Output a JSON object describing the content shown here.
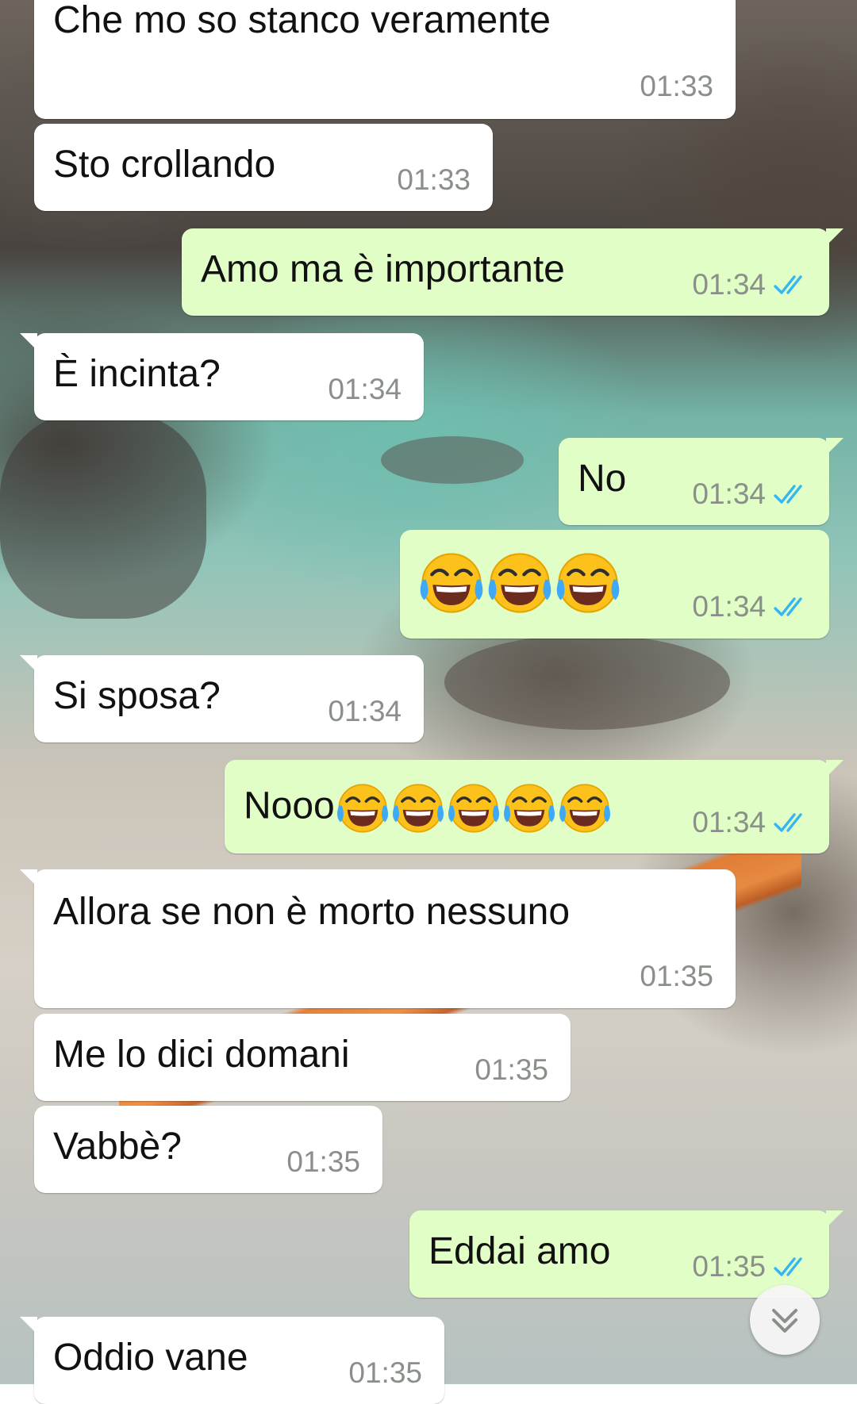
{
  "chat": {
    "messages": [
      {
        "text": "Che mo so stanco veramente",
        "time": "01:33",
        "direction": "in"
      },
      {
        "text": "Sto crollando",
        "time": "01:33",
        "direction": "in"
      },
      {
        "text": "Amo ma è importante",
        "time": "01:34",
        "direction": "out",
        "status": "read"
      },
      {
        "text": "È incinta?",
        "time": "01:34",
        "direction": "in"
      },
      {
        "text": "No",
        "time": "01:34",
        "direction": "out",
        "status": "read"
      },
      {
        "text": "😂😂😂",
        "time": "01:34",
        "direction": "out",
        "status": "read"
      },
      {
        "text": "Si sposa?",
        "time": "01:34",
        "direction": "in"
      },
      {
        "text": "Nooo😂😂😂😂😂",
        "time": "01:34",
        "direction": "out",
        "status": "read"
      },
      {
        "text": "Allora se non è morto nessuno",
        "time": "01:35",
        "direction": "in"
      },
      {
        "text": "Me lo dici domani",
        "time": "01:35",
        "direction": "in"
      },
      {
        "text": "Vabbè?",
        "time": "01:35",
        "direction": "in"
      },
      {
        "text": "Eddai amo",
        "time": "01:35",
        "direction": "out",
        "status": "read"
      },
      {
        "text": "Oddio vane",
        "time": "01:35",
        "direction": "in"
      }
    ],
    "nooo_prefix": "Nooo"
  },
  "icons": {
    "read_receipt": "double-check-icon",
    "emoji": "face-with-tears-of-joy-emoji",
    "scroll_down": "chevron-double-down-icon"
  },
  "colors": {
    "incoming_bubble": "#ffffff",
    "outgoing_bubble": "#e1fec6",
    "read_ticks": "#34b7f1",
    "timestamp": "#8a8f8a"
  }
}
